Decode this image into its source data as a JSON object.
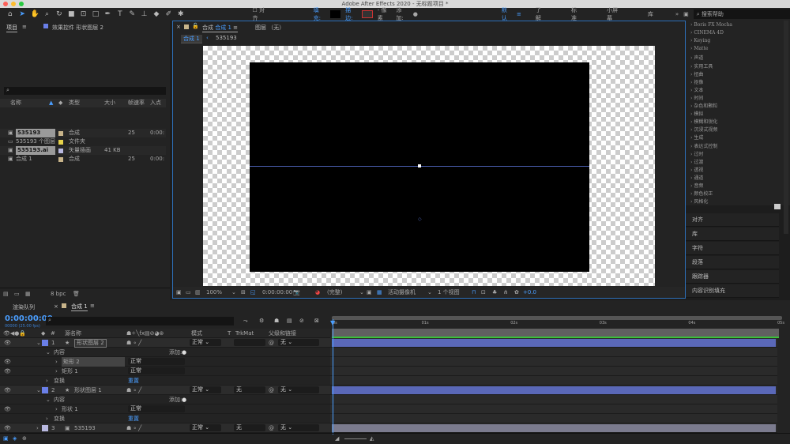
{
  "window": {
    "title": "Adobe After Effects 2020 - 无标题项目 *"
  },
  "toolbar": {
    "align_label": "对齐",
    "fill_label": "填充:",
    "stroke_label": "描边:",
    "stroke_width": "- 像素",
    "add_label": "添加:",
    "workspaces": [
      "默认",
      "了解",
      "标准",
      "小屏幕",
      "库"
    ],
    "search_placeholder": "搜索帮助"
  },
  "project": {
    "tab": "项目",
    "effect_controls_tab": "效果控件 形状图层 2",
    "search_placeholder": "",
    "columns": [
      "名称",
      "类型",
      "大小",
      "帧速率",
      "入点"
    ],
    "items": [
      {
        "name": "535193",
        "type": "合成",
        "size": "",
        "fps": "25",
        "in": "0:00:"
      },
      {
        "name": "535193 个图层",
        "type": "文件夹",
        "size": "",
        "fps": "",
        "in": ""
      },
      {
        "name": "535193.ai",
        "type": "矢量插画",
        "size": "41 KB",
        "fps": "",
        "in": ""
      },
      {
        "name": "合成 1",
        "type": "合成",
        "size": "",
        "fps": "25",
        "in": "0:00:"
      }
    ],
    "bpc": "8 bpc",
    "label_colors": [
      "#c8b48a",
      "#e6d24b",
      "#b8b8e0",
      "#c8b48a"
    ]
  },
  "comp": {
    "tab_prefix": "合成",
    "tab_name": "合成 1",
    "layer_tab": "图层 （无）",
    "breadcrumbs": [
      "合成 1",
      "535193"
    ],
    "zoom": "100%",
    "timecode": "0:00:00:00",
    "resolution": "(完整)",
    "camera": "活动摄像机",
    "views": "1 个视图",
    "exposure": "+0.0"
  },
  "effects": {
    "categories": [
      "Boris FX Mocha",
      "CINEMA 4D",
      "Keying",
      "Matte",
      "声道",
      "实用工具",
      "扭曲",
      "抠像",
      "文本",
      "时间",
      "杂色和颗粒",
      "模拟",
      "模糊和锐化",
      "沉浸式视频",
      "生成",
      "表达式控制",
      "过时",
      "过渡",
      "透视",
      "通道",
      "音频",
      "颜色校正",
      "风格化"
    ]
  },
  "side_panels": [
    "对齐",
    "库",
    "字符",
    "段落",
    "跟踪器",
    "内容识别填充"
  ],
  "timeline": {
    "render_queue_tab": "渲染队列",
    "comp_tab": "合成 1",
    "timecode": "0:00:00:00",
    "fps_sub": "00000 (25.00 fps)",
    "headers": {
      "num": "#",
      "source": "源名称",
      "mode": "模式",
      "t": "T",
      "trkmat": "TrkMat",
      "parent": "父级和链接"
    },
    "ruler": [
      "0s",
      "01s",
      "02s",
      "03s",
      "04s",
      "05s"
    ],
    "layers": [
      {
        "num": "1",
        "name": "形状图层 2",
        "mode": "正常",
        "trkmat": "",
        "parent": "无",
        "color": "#6a7fe8"
      },
      {
        "num": "2",
        "name": "形状图层 1",
        "mode": "正常",
        "trkmat": "无",
        "parent": "无",
        "color": "#6a7fe8"
      },
      {
        "num": "3",
        "name": "535193",
        "mode": "正常",
        "trkmat": "无",
        "parent": "无",
        "color": "#b8b8e0"
      }
    ],
    "contents": "内容",
    "add": "添加:",
    "transform": "变换",
    "reset": "重置",
    "groups": [
      {
        "name": "矩形 2",
        "mode": "正常"
      },
      {
        "name": "矩形 1",
        "mode": "正常"
      },
      {
        "name": "形状 1",
        "mode": "正常"
      }
    ]
  }
}
